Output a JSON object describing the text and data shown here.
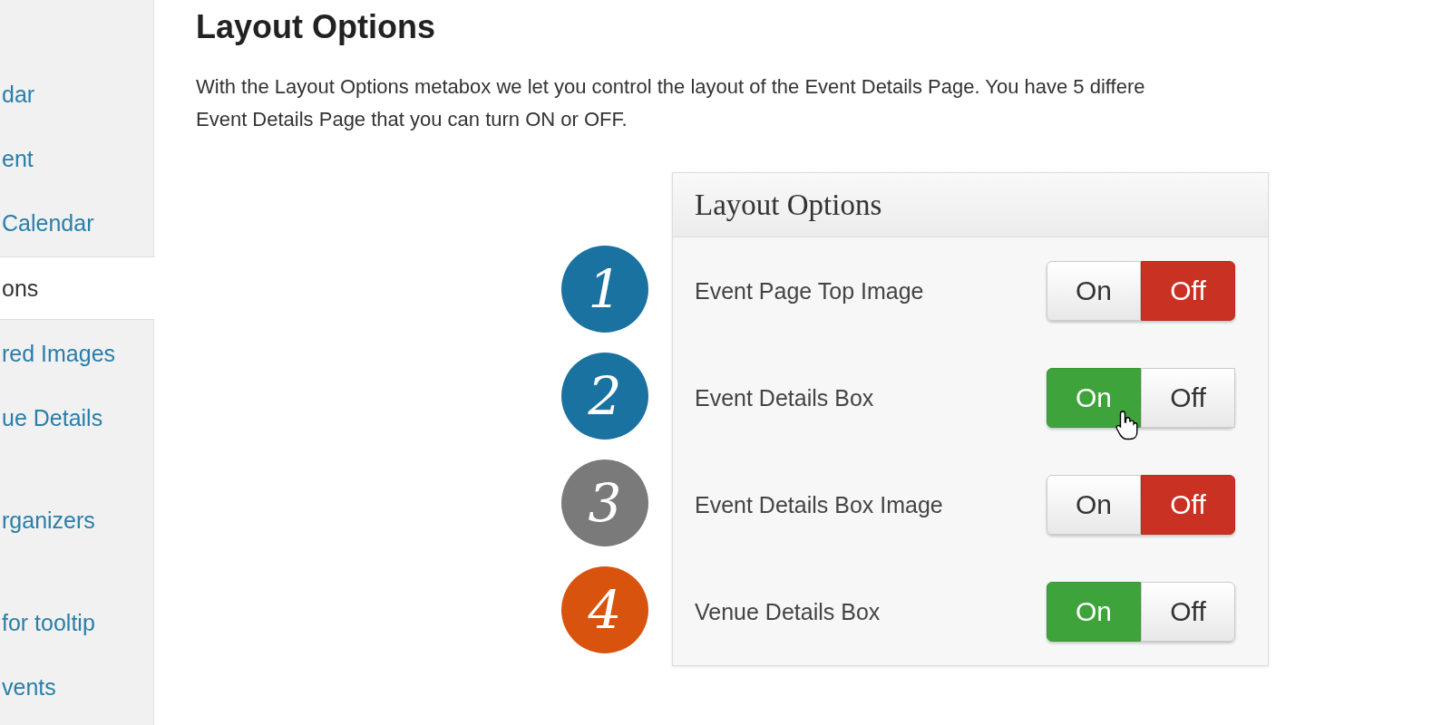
{
  "sidebar": {
    "items": [
      {
        "label": "dar",
        "selected": false
      },
      {
        "label": "ent",
        "selected": false
      },
      {
        "label": "Calendar",
        "selected": false
      },
      {
        "label": "ons",
        "selected": true
      },
      {
        "label": "red Images",
        "selected": false
      },
      {
        "label": "ue Details",
        "selected": false
      },
      {
        "label": "rganizers",
        "selected": false
      },
      {
        "label": "for tooltip",
        "selected": false
      },
      {
        "label": "vents",
        "selected": false
      }
    ]
  },
  "heading": "Layout Options",
  "intro": [
    "With the Layout Options metabox we let you control the layout of the Event Details Page. You have 5 differe",
    "Event Details Page that you can turn ON or OFF."
  ],
  "metabox": {
    "title": "Layout Options",
    "rows": [
      {
        "number": "1",
        "color": "#1a72a0",
        "label": "Event Page Top Image",
        "on": false,
        "on_label": "On",
        "off_label": "Off"
      },
      {
        "number": "2",
        "color": "#1a72a0",
        "label": "Event Details Box",
        "on": true,
        "on_label": "On",
        "off_label": "Off"
      },
      {
        "number": "3",
        "color": "#7a7a7a",
        "label": "Event Details Box Image",
        "on": false,
        "on_label": "On",
        "off_label": "Off"
      },
      {
        "number": "4",
        "color": "#d8540e",
        "label": "Venue Details Box",
        "on": true,
        "on_label": "On",
        "off_label": "Off"
      }
    ]
  }
}
